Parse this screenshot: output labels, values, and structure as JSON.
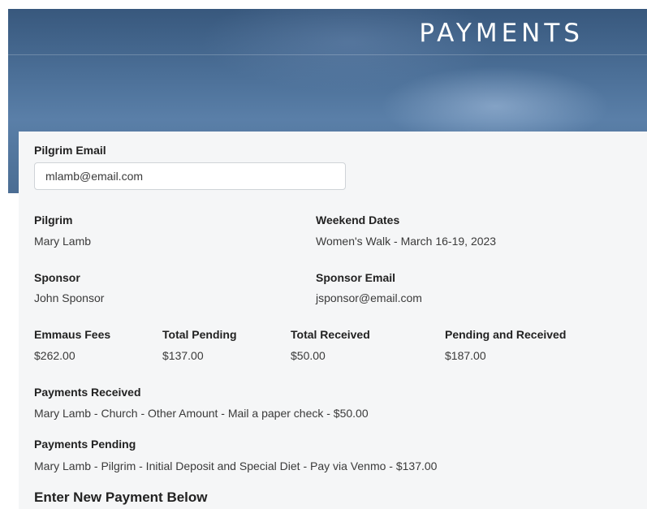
{
  "header": {
    "title": "PAYMENTS"
  },
  "pilgrim_email": {
    "label": "Pilgrim Email",
    "value": "mlamb@email.com"
  },
  "pilgrim": {
    "label": "Pilgrim",
    "value": "Mary Lamb"
  },
  "weekend_dates": {
    "label": "Weekend Dates",
    "value": "Women's Walk - March 16-19, 2023"
  },
  "sponsor": {
    "label": "Sponsor",
    "value": "John Sponsor"
  },
  "sponsor_email": {
    "label": "Sponsor Email",
    "value": "jsponsor@email.com"
  },
  "fees": {
    "emmaus": {
      "label": "Emmaus Fees",
      "value": "$262.00"
    },
    "total_pending": {
      "label": "Total Pending",
      "value": "$137.00"
    },
    "total_received": {
      "label": "Total Received",
      "value": "$50.00"
    },
    "pending_and_received": {
      "label": "Pending and Received",
      "value": "$187.00"
    }
  },
  "payments_received": {
    "label": "Payments Received",
    "items": [
      "Mary Lamb - Church - Other Amount - Mail a paper check - $50.00"
    ]
  },
  "payments_pending": {
    "label": "Payments Pending",
    "items": [
      "Mary Lamb - Pilgrim - Initial Deposit and Special Diet - Pay via Venmo - $137.00"
    ]
  },
  "new_payment": {
    "heading": "Enter New Payment Below"
  }
}
